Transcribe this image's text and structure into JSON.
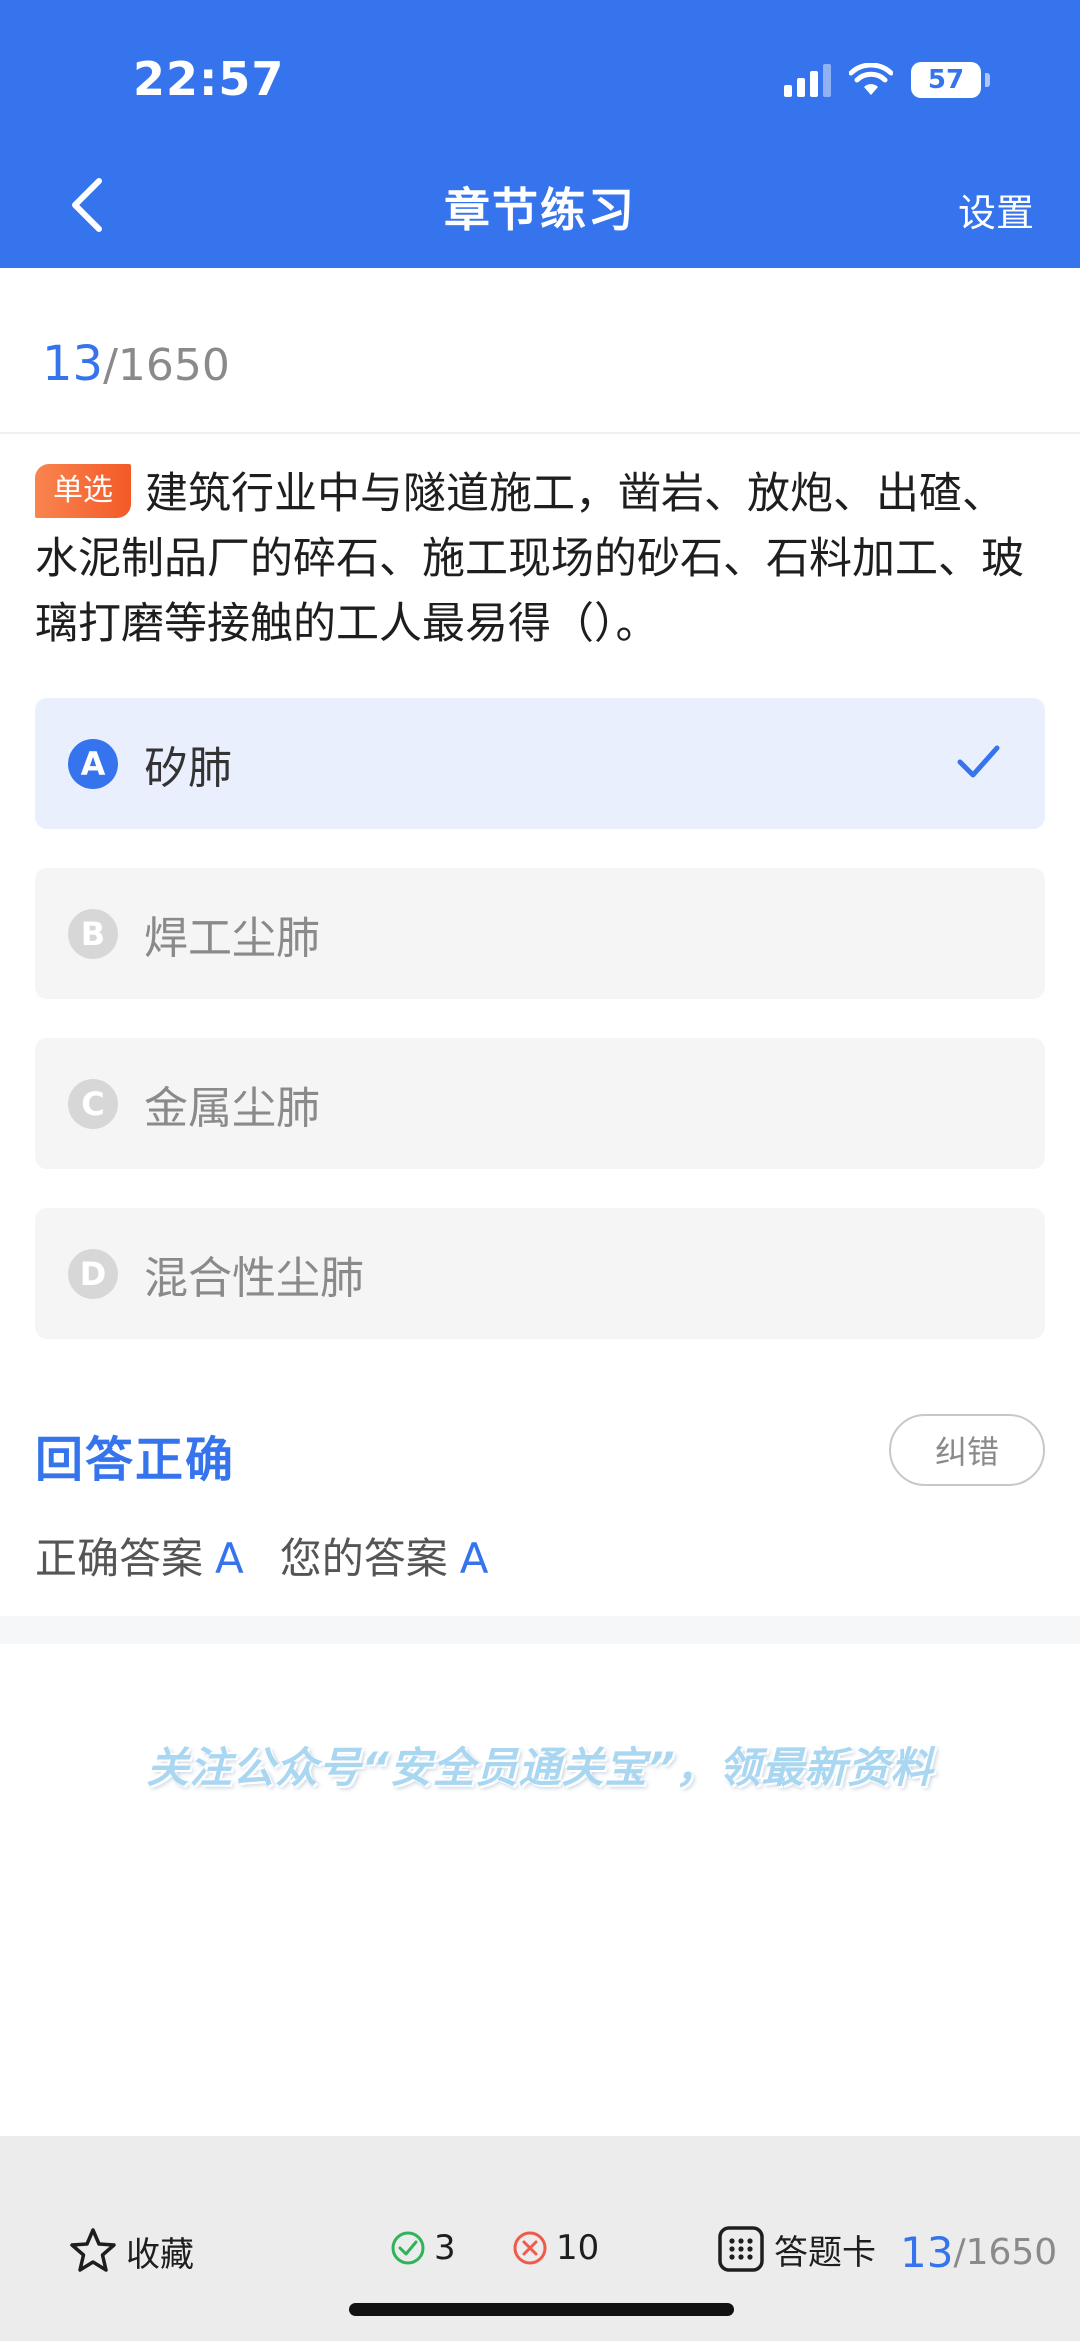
{
  "status": {
    "time": "22:57",
    "battery": "57",
    "battery_level": 0.57
  },
  "nav": {
    "title": "章节练习",
    "settings": "设置"
  },
  "progress": {
    "current": "13",
    "total": "/1650"
  },
  "question": {
    "type": "单选",
    "text": "建筑行业中与隧道施工，凿岩、放炮、出碴、水泥制品厂的碎石、施工现场的砂石、石料加工、玻璃打磨等接触的工人最易得（）。"
  },
  "options": [
    {
      "letter": "A",
      "text": "矽肺",
      "selected": true
    },
    {
      "letter": "B",
      "text": "焊工尘肺",
      "selected": false
    },
    {
      "letter": "C",
      "text": "金属尘肺",
      "selected": false
    },
    {
      "letter": "D",
      "text": "混合性尘肺",
      "selected": false
    }
  ],
  "result": {
    "title": "回答正确",
    "report_label": "纠错",
    "correct_label": "正确答案",
    "correct_value": "A",
    "yours_label": "您的答案",
    "yours_value": "A"
  },
  "promo": {
    "text": "关注公众号“安全员通关宝”，领最新资料"
  },
  "bottom_bar": {
    "favorite_label": "收藏",
    "correct_count": "3",
    "wrong_count": "10",
    "card_label": "答题卡",
    "page_current": "13",
    "page_total": "/1650"
  },
  "colors": {
    "primary": "#3574ed",
    "badge": "#f45a28",
    "correct": "#2fb35a",
    "wrong": "#f05a4a"
  }
}
